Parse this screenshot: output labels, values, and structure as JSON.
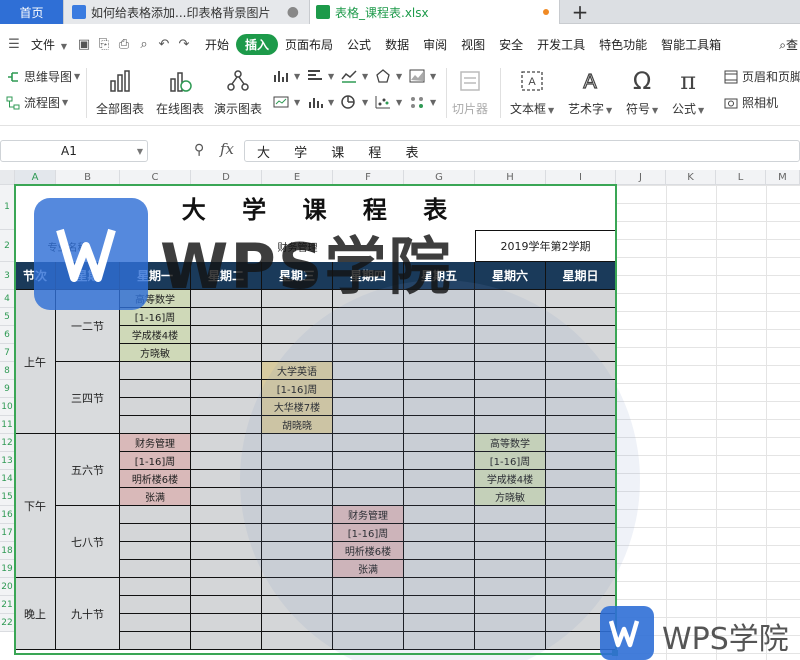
{
  "tabs": {
    "home": "首页",
    "doc": "如何给表格添加...印表格背景图片",
    "xls": "表格_课程表.xlsx",
    "new_tab": "+"
  },
  "menu": {
    "file": "文件",
    "items": [
      "开始",
      "插入",
      "页面布局",
      "公式",
      "数据",
      "审阅",
      "视图",
      "安全",
      "开发工具",
      "特色功能",
      "智能工具箱"
    ],
    "active": "插入",
    "search": "查"
  },
  "ribbon": {
    "mindmap": "思维导图",
    "flowchart": "流程图",
    "all_charts": "全部图表",
    "online_charts": "在线图表",
    "demo_charts": "演示图表",
    "slicer": "切片器",
    "textbox": "文本框",
    "wordart": "艺术字",
    "symbol": "符号",
    "formula": "公式",
    "header_footer": "页眉和页脚",
    "camera": "照相机"
  },
  "formula_bar": {
    "cell_ref": "A1",
    "fx": "fx",
    "content": "大 学 课 程 表"
  },
  "sheet": {
    "columns": [
      "A",
      "B",
      "C",
      "D",
      "E",
      "F",
      "G",
      "H",
      "I",
      "J",
      "K",
      "L",
      "M"
    ],
    "rows": [
      "1",
      "2",
      "3",
      "4",
      "5",
      "6",
      "7",
      "8",
      "9",
      "10",
      "11",
      "12",
      "13",
      "14",
      "15",
      "16",
      "17",
      "18",
      "19",
      "20",
      "21",
      "22"
    ],
    "title": "大 学 课 程 表",
    "major_label": "专业名称",
    "major_value": "财务管理",
    "term": "2019学年第2学期",
    "header": [
      "节次",
      "星期",
      "星期一",
      "星期二",
      "星期三",
      "星期四",
      "星期五",
      "星期六",
      "星期日"
    ],
    "periods": {
      "morning": "上午",
      "afternoon": "下午",
      "evening": "晚上",
      "p12": "一二节",
      "p34": "三四节",
      "p56": "五六节",
      "p78": "七八节",
      "p910": "九十节"
    },
    "courses": {
      "mon_12": [
        "高等数学",
        "[1-16]周",
        "学成楼4楼",
        "方晓敏"
      ],
      "wed_34": [
        "大学英语",
        "[1-16]周",
        "大华楼7楼",
        "胡晓晓"
      ],
      "mon_56": [
        "财务管理",
        "[1-16]周",
        "明析楼6楼",
        "张满"
      ],
      "sat_56": [
        "高等数学",
        "[1-16]周",
        "学成楼4楼",
        "方晓敏"
      ],
      "thu_78": [
        "财务管理",
        "[1-16]周",
        "明析楼6楼",
        "张满"
      ]
    }
  },
  "watermark": {
    "brand": "WPS学院"
  },
  "colors": {
    "accent_green": "#1d9a4a",
    "header_navy": "#1a3a5a",
    "wps_blue": "#2f6fd6",
    "course_green": "#cfd9b8",
    "course_tan": "#d8cba0",
    "course_pink": "#d9b9b9",
    "cell_gray": "#d4d6d8"
  }
}
